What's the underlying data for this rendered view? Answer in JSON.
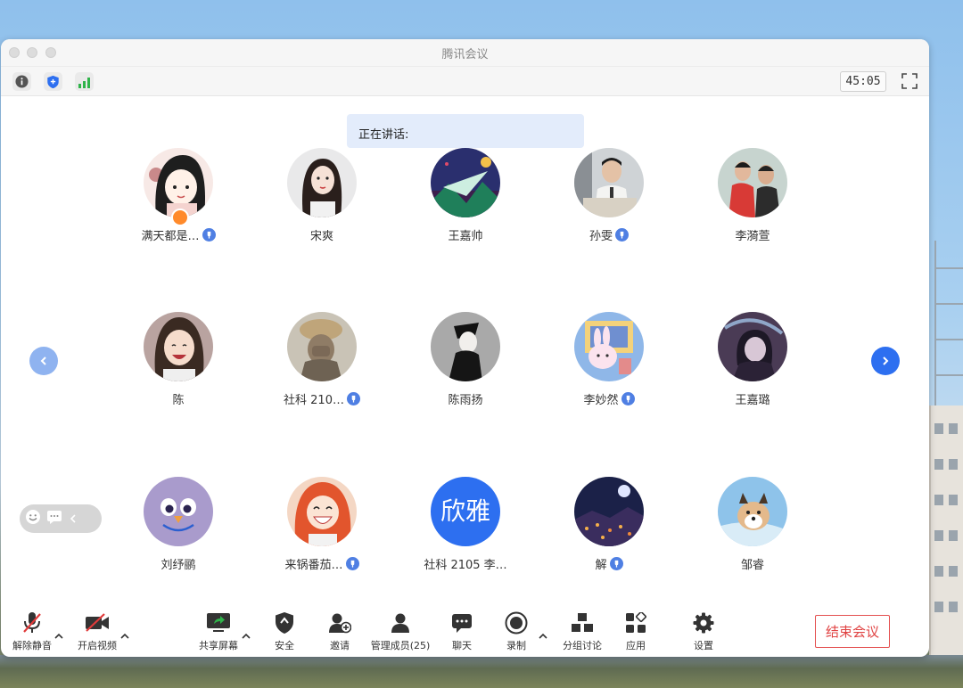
{
  "window": {
    "title": "腾讯会议"
  },
  "top_bar": {
    "timer": "45:05"
  },
  "speaking": {
    "label": "正在讲话:"
  },
  "participants": [
    {
      "name": "满天都是…",
      "verified": true,
      "host": true,
      "avatar": "cartoon-girl"
    },
    {
      "name": "宋爽",
      "verified": false,
      "avatar": "photo-woman"
    },
    {
      "name": "王嘉帅",
      "verified": false,
      "avatar": "paper-plane"
    },
    {
      "name": "孙雯",
      "verified": true,
      "avatar": "photo-man"
    },
    {
      "name": "李漪萱",
      "verified": false,
      "avatar": "photo-couple"
    },
    {
      "name": "陈",
      "verified": false,
      "avatar": "photo-girl-laughing"
    },
    {
      "name": "社科 210…",
      "verified": true,
      "avatar": "photo-hat"
    },
    {
      "name": "陈雨扬",
      "verified": false,
      "avatar": "sketch-figure"
    },
    {
      "name": "李妙然",
      "verified": true,
      "avatar": "bunny"
    },
    {
      "name": "王嘉璐",
      "verified": false,
      "avatar": "anime-dark"
    },
    {
      "name": "刘纾鹂",
      "verified": false,
      "avatar": "purple-face"
    },
    {
      "name": "来锅番茄…",
      "verified": true,
      "avatar": "cartoon-redhead"
    },
    {
      "name": "社科 2105 李…",
      "verified": false,
      "avatar_text": "欣雅"
    },
    {
      "name": "解",
      "verified": true,
      "avatar": "night-city"
    },
    {
      "name": "邹睿",
      "verified": false,
      "avatar": "shiba-dog"
    }
  ],
  "toolbar": {
    "mute": "解除静音",
    "video": "开启视频",
    "share": "共享屏幕",
    "security": "安全",
    "invite": "邀请",
    "members": "管理成员(25)",
    "chat": "聊天",
    "record": "录制",
    "breakout": "分组讨论",
    "apps": "应用",
    "settings": "设置",
    "end": "结束会议"
  },
  "colors": {
    "accent": "#2d6ff0",
    "end": "#e04343",
    "speaking_bg": "#e3ecfb"
  }
}
